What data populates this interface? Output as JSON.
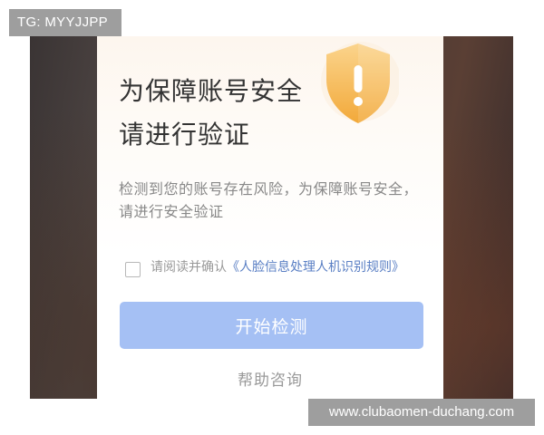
{
  "watermarks": {
    "top_left": "TG: MYYJJPP",
    "bottom_right": "www.clubaomen-duchang.com"
  },
  "dialog": {
    "title_line1": "为保障账号安全",
    "title_line2": "请进行验证",
    "description": "检测到您的账号存在风险，为保障账号安全，请进行安全验证",
    "agreement_prefix": "请阅读并确认",
    "agreement_link": "《人脸信息处理人机识别规则》",
    "agreement_checked": false,
    "start_button": "开始检测",
    "help_link": "帮助咨询",
    "shield_icon": "shield-warning-icon",
    "colors": {
      "button": "#a5c0f4",
      "link": "#5a7fc4",
      "shield": "#f6b94c"
    }
  }
}
